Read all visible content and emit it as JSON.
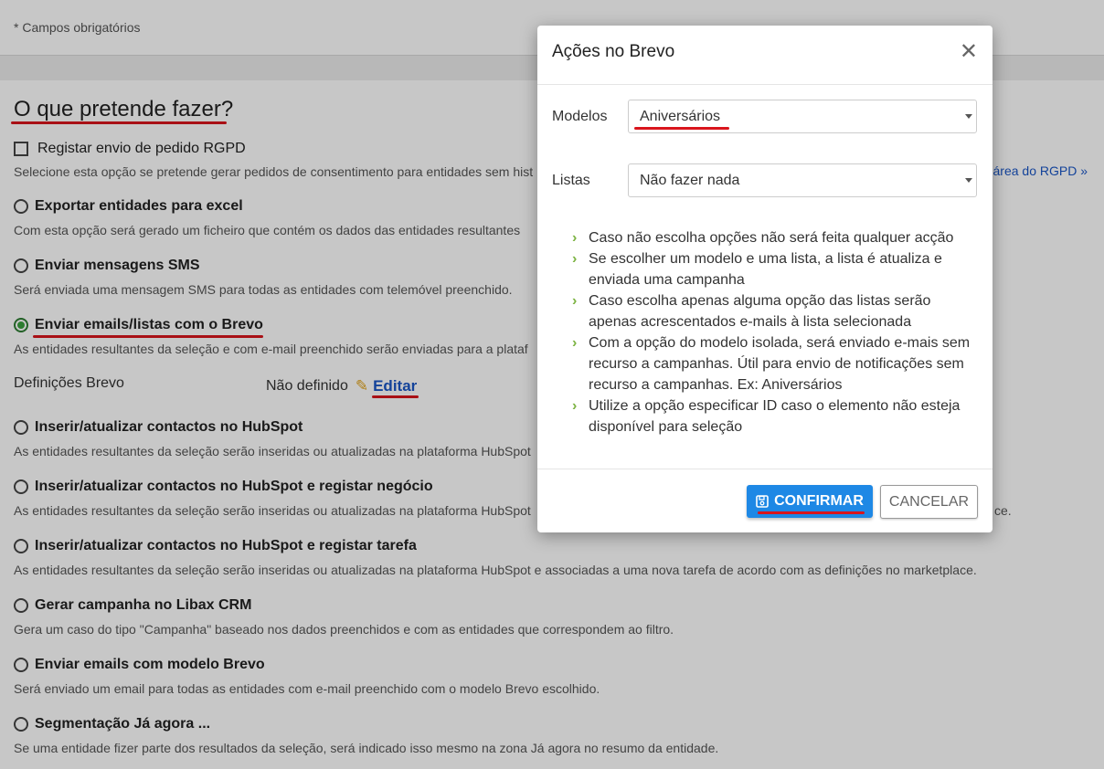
{
  "page": {
    "required_note": "* Campos obrigatórios",
    "section_title": "O que pretende fazer?",
    "rgpd_link": "área do RGPD »",
    "options": [
      {
        "title": "Registar envio de pedido RGPD",
        "desc": "Selecione esta opção se pretende gerar pedidos de consentimento para entidades sem hist"
      },
      {
        "title": "Exportar entidades para excel",
        "desc": "Com esta opção será gerado um ficheiro que contém os dados das entidades resultantes"
      },
      {
        "title": "Enviar mensagens SMS",
        "desc": "Será enviada uma mensagem SMS para todas as entidades com telemóvel preenchido."
      },
      {
        "title": "Enviar emails/listas com o Brevo",
        "desc": "As entidades resultantes da seleção e com e-mail preenchido serão enviadas para a plataf"
      },
      {
        "title": "Inserir/atualizar contactos no HubSpot",
        "desc": "As entidades resultantes da seleção serão inseridas ou atualizadas na plataforma HubSpot"
      },
      {
        "title": "Inserir/atualizar contactos no HubSpot e registar negócio",
        "desc": "As entidades resultantes da seleção serão inseridas ou atualizadas na plataforma HubSpot",
        "desc_tail": "ce."
      },
      {
        "title": "Inserir/atualizar contactos no HubSpot e registar tarefa",
        "desc": "As entidades resultantes da seleção serão inseridas ou atualizadas na plataforma HubSpot e associadas a uma nova tarefa de acordo com as definições no marketplace."
      },
      {
        "title": "Gerar campanha no Libax CRM",
        "desc": "Gera um caso do tipo \"Campanha\" baseado nos dados preenchidos e com as entidades que correspondem ao filtro."
      },
      {
        "title": "Enviar emails com modelo Brevo",
        "desc": "Será enviado um email para todas as entidades com e-mail preenchido com o modelo Brevo escolhido."
      },
      {
        "title": "Segmentação Já agora ...",
        "desc": "Se uma entidade fizer parte dos resultados da seleção, será indicado isso mesmo na zona Já agora no resumo da entidade."
      }
    ],
    "brevo_settings": {
      "label": "Definições Brevo",
      "status": "Não definido",
      "edit_label": "Editar"
    }
  },
  "modal": {
    "title": "Ações no Brevo",
    "close_glyph": "✕",
    "models_label": "Modelos",
    "models_value": "Aniversários",
    "lists_label": "Listas",
    "lists_value": "Não fazer nada",
    "info": [
      "Caso não escolha opções não será feita qualquer acção",
      "Se escolher um modelo e uma lista, a lista é atualiza e enviada uma campanha",
      "Caso escolha apenas alguma opção das listas serão apenas acrescentados e-mails à lista selecionada",
      "Com a opção do modelo isolada, será enviado e-mais sem recurso a campanhas. Útil para envio de notificações sem recurso a campanhas. Ex: Aniversários",
      "Utilize a opção especificar ID caso o elemento não esteja disponível para seleção"
    ],
    "confirm_label": "CONFIRMAR",
    "cancel_label": "CANCELAR"
  },
  "colors": {
    "accent": "#1e88e5",
    "link": "#1a56c6",
    "highlight_underline": "#d9151c",
    "check_green": "#7cb342"
  },
  "icons": {
    "confirm": "save-disk-icon",
    "edit": "pencil-icon",
    "info_bullet": "chevron-right-icon"
  }
}
